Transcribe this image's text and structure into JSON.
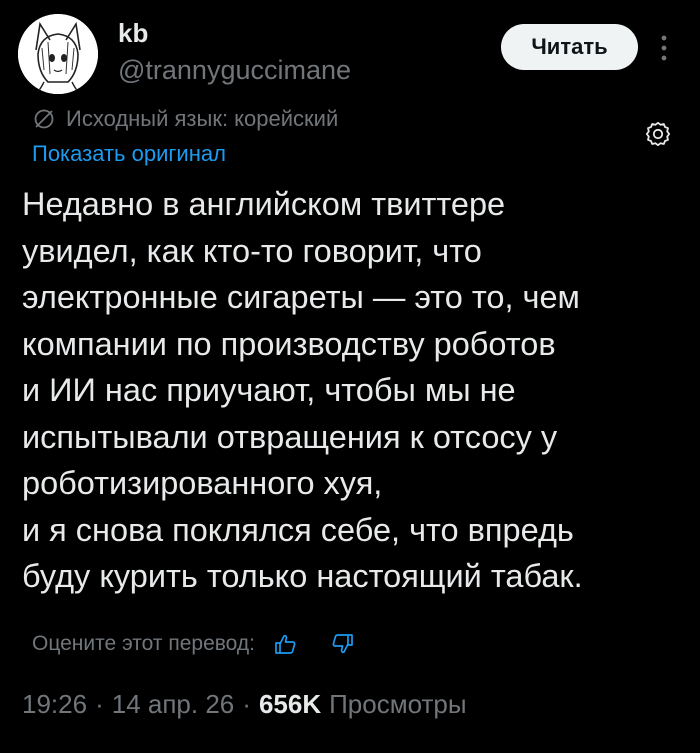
{
  "author": {
    "display_name": "kb",
    "handle": "@trannyguccimane"
  },
  "follow_button": {
    "label": "Читать"
  },
  "translation": {
    "translated_from": "Исходный язык: корейский",
    "show_original": "Показать оригинал"
  },
  "tweet": {
    "lines": [
      "Недавно в английском твиттере",
      "увидел, как кто-то говорит, что",
      "электронные сигареты — это то, чем",
      "компании по производству роботов",
      "и ИИ нас приучают, чтобы мы не",
      "испытывали отвращения к отсосу у",
      "роботизированного хуя,",
      "и я снова поклялся себе, что впредь",
      "буду курить только настоящий табак."
    ]
  },
  "rate_translation": {
    "label": "Оцените этот перевод:"
  },
  "meta": {
    "time": "19:26",
    "date": "14 апр. 26",
    "views_count": "656K",
    "views_label": "Просмотры",
    "separator": "·"
  },
  "colors": {
    "background": "#000000",
    "text_primary": "#e7e9ea",
    "text_secondary": "#71767b",
    "link": "#1d9bf0",
    "button_bg": "#eff3f4",
    "button_text": "#0f1419"
  }
}
